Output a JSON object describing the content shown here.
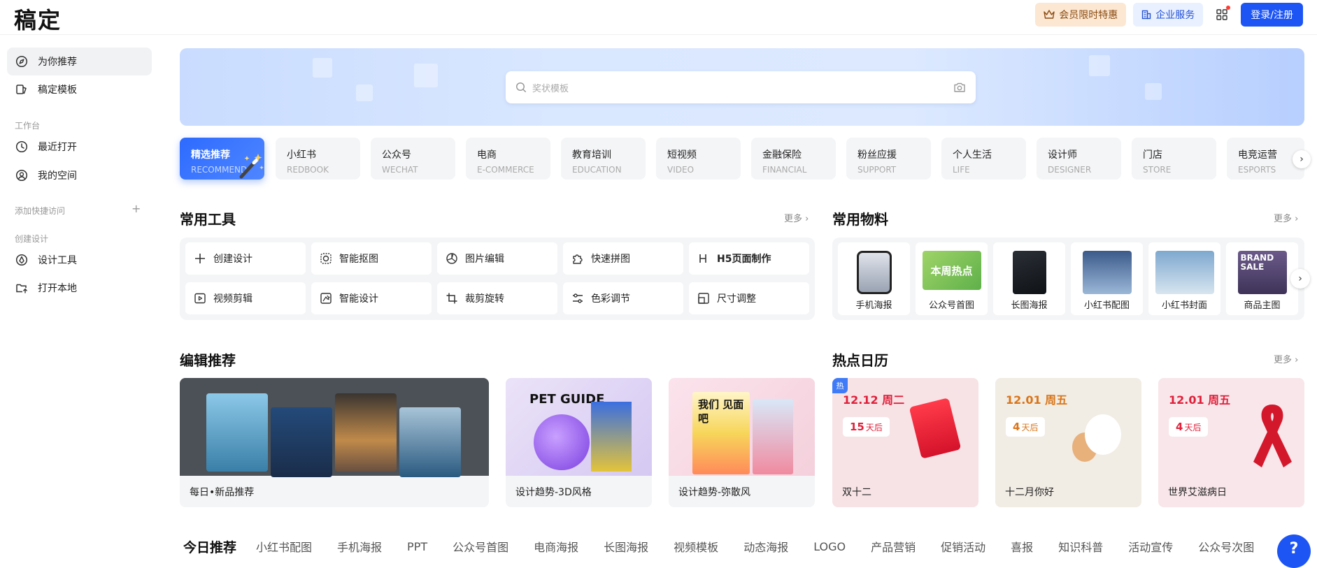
{
  "brand": {
    "logo": "稿定"
  },
  "header": {
    "vip_label": "会员限时特惠",
    "enterprise_label": "企业服务",
    "login_label": "登录/注册"
  },
  "sidebar": {
    "items": [
      {
        "label": "为你推荐",
        "icon": "compass-icon"
      },
      {
        "label": "稿定模板",
        "icon": "template-icon"
      }
    ],
    "workbench_title": "工作台",
    "workbench": [
      {
        "label": "最近打开",
        "icon": "clock-icon"
      },
      {
        "label": "我的空间",
        "icon": "user-circle-icon"
      }
    ],
    "quick_access_title": "添加快捷访问",
    "create_title": "创建设计",
    "create": [
      {
        "label": "设计工具",
        "icon": "pen-icon"
      },
      {
        "label": "打开本地",
        "icon": "folder-upload-icon"
      }
    ]
  },
  "search": {
    "placeholder": "奖状模板"
  },
  "categories": [
    {
      "cn": "精选推荐",
      "en": "RECOMMEND"
    },
    {
      "cn": "小红书",
      "en": "REDBOOK"
    },
    {
      "cn": "公众号",
      "en": "WECHAT"
    },
    {
      "cn": "电商",
      "en": "E-COMMERCE"
    },
    {
      "cn": "教育培训",
      "en": "EDUCATION"
    },
    {
      "cn": "短视频",
      "en": "VIDEO"
    },
    {
      "cn": "金融保险",
      "en": "FINANCIAL"
    },
    {
      "cn": "粉丝应援",
      "en": "SUPPORT"
    },
    {
      "cn": "个人生活",
      "en": "LIFE"
    },
    {
      "cn": "设计师",
      "en": "DESIGNER"
    },
    {
      "cn": "门店",
      "en": "STORE"
    },
    {
      "cn": "电竞运营",
      "en": "ESPORTS"
    }
  ],
  "tools": {
    "title": "常用工具",
    "more": "更多",
    "items": [
      {
        "label": "创建设计",
        "icon": "plus-icon"
      },
      {
        "label": "智能抠图",
        "icon": "cutout-icon"
      },
      {
        "label": "图片编辑",
        "icon": "image-edit-icon"
      },
      {
        "label": "快速拼图",
        "icon": "puzzle-icon"
      },
      {
        "label": "H5页面制作",
        "icon": "h5-icon"
      },
      {
        "label": "视频剪辑",
        "icon": "video-icon"
      },
      {
        "label": "智能设计",
        "icon": "smart-design-icon"
      },
      {
        "label": "裁剪旋转",
        "icon": "crop-icon"
      },
      {
        "label": "色彩调节",
        "icon": "sliders-icon"
      },
      {
        "label": "尺寸调整",
        "icon": "resize-icon"
      }
    ]
  },
  "materials": {
    "title": "常用物料",
    "more": "更多",
    "items": [
      "手机海报",
      "公众号首图",
      "长图海报",
      "小红书配图",
      "小红书封面",
      "商品主图"
    ],
    "thumb_texts": [
      "本周热点",
      "BRAND SALE"
    ]
  },
  "editor_picks": {
    "title": "编辑推荐",
    "cards": [
      "每日•新品推荐",
      "设计趋势-3D风格",
      "设计趋势-弥散风"
    ],
    "thumb_texts": [
      "PET GUIDE",
      "我们 见面吧"
    ]
  },
  "hot_calendar": {
    "title": "热点日历",
    "more": "更多",
    "hot_tag": "热",
    "days_suffix": "天后",
    "cards": [
      {
        "date": "12.12 周二",
        "days": "15",
        "name": "双十二",
        "color": "#e0203a",
        "bg": "#f7e3e6"
      },
      {
        "date": "12.01 周五",
        "days": "4",
        "name": "十二月你好",
        "color": "#d9751a",
        "bg": "#f1ece4"
      },
      {
        "date": "12.01 周五",
        "days": "4",
        "name": "世界艾滋病日",
        "color": "#e0203a",
        "bg": "#f8e6ea"
      }
    ]
  },
  "today": {
    "title": "今日推荐",
    "tabs": [
      "小红书配图",
      "手机海报",
      "PPT",
      "公众号首图",
      "电商海报",
      "长图海报",
      "视频模板",
      "动态海报",
      "LOGO",
      "产品营销",
      "促销活动",
      "喜报",
      "知识科普",
      "活动宣传",
      "公众号次图"
    ]
  },
  "help": {
    "label": "?"
  },
  "colors": {
    "primary": "#1d55f5",
    "vip_bg": "#fce7d2",
    "panel_bg": "#f4f5f7"
  }
}
